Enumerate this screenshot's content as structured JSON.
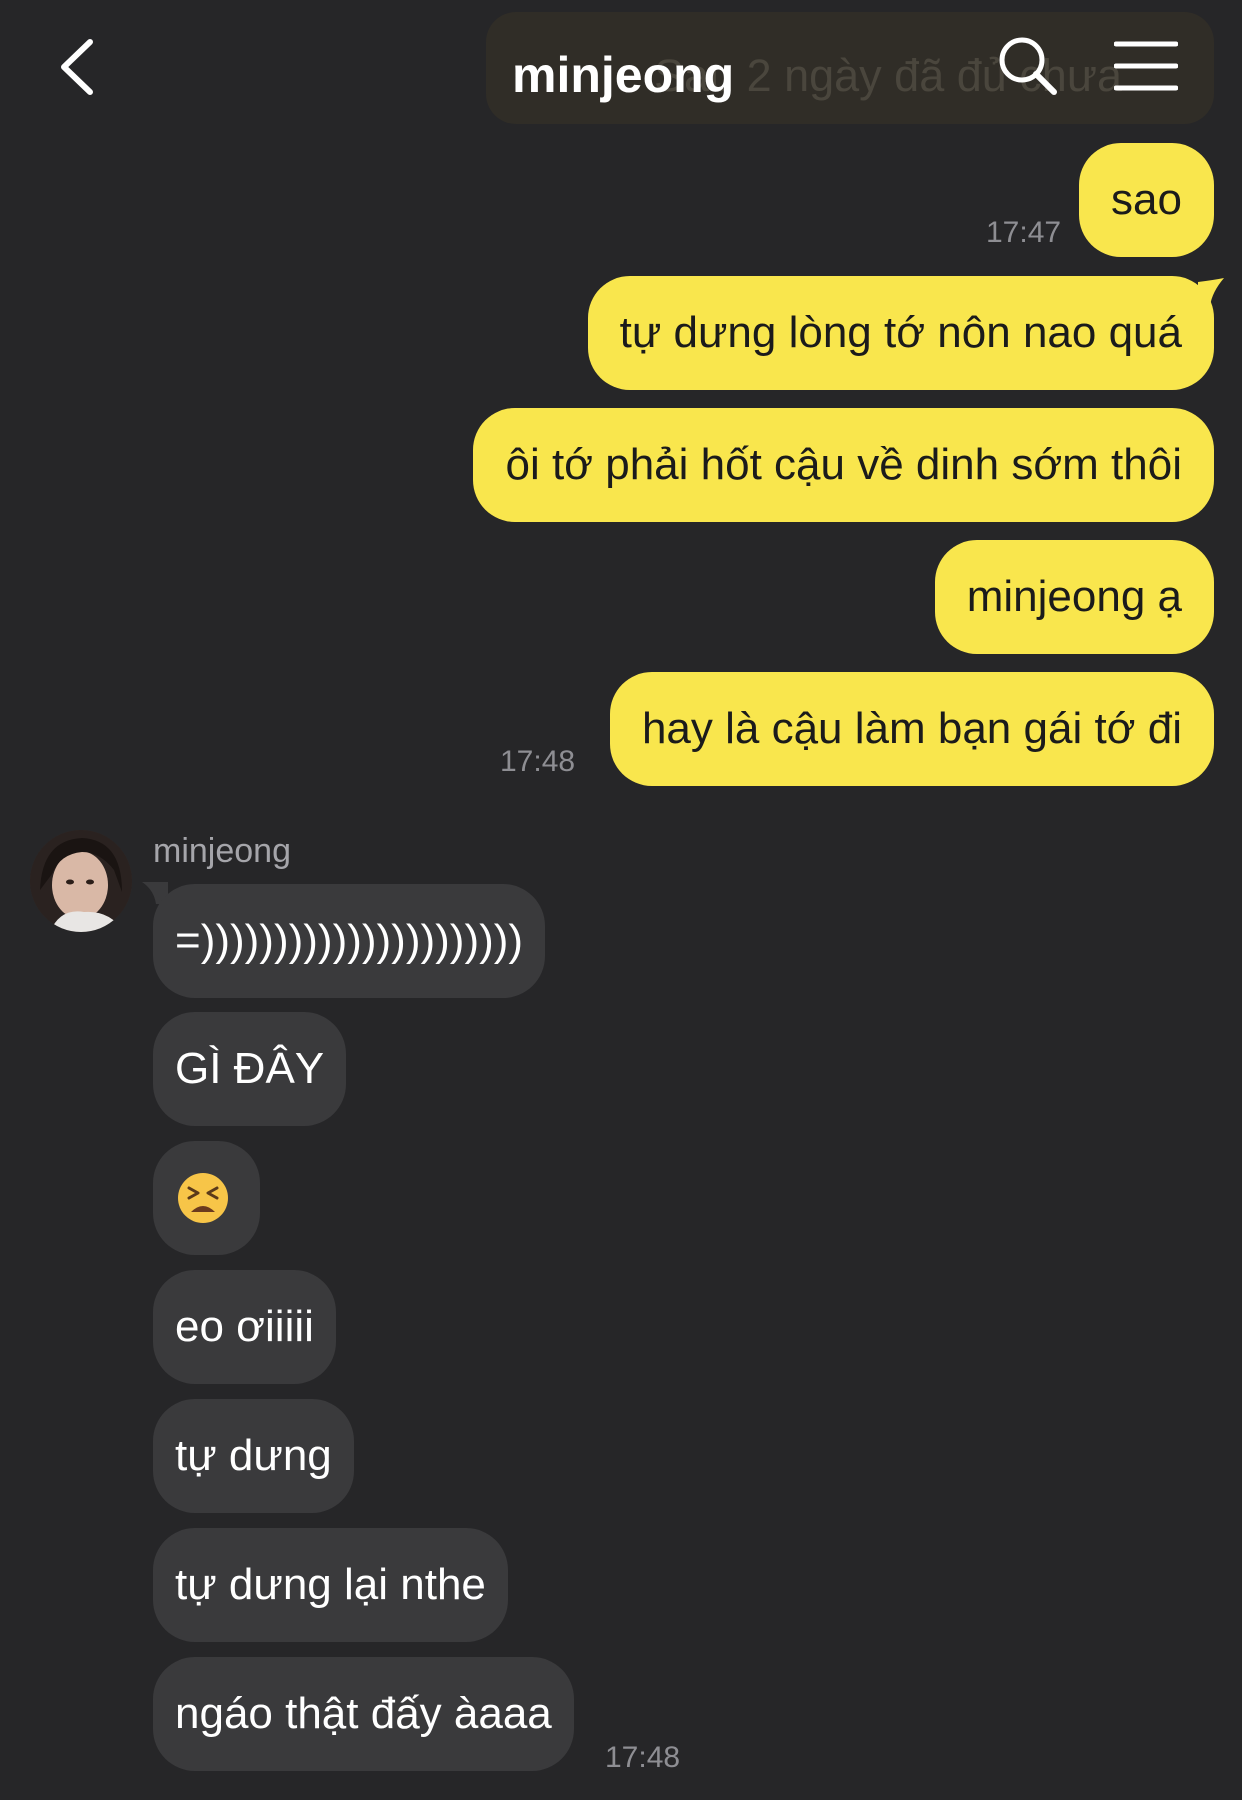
{
  "header": {
    "title": "minjeong",
    "ghost_text": "Sau 2 ngày đã đủ chưa"
  },
  "messages": {
    "outgoing": [
      {
        "text": "sao"
      },
      {
        "text": "tự dưng lòng tớ nôn nao quá"
      },
      {
        "text": "ôi tớ phải hốt cậu về dinh sớm thôi"
      },
      {
        "text": "minjeong ạ"
      },
      {
        "text": "hay là cậu làm bạn gái tớ đi"
      }
    ],
    "outgoing_times": [
      "17:47",
      "17:48"
    ],
    "sender_name": "minjeong",
    "incoming": [
      {
        "text": "=))))))))))))))))))))))"
      },
      {
        "text": "GÌ ĐÂY"
      },
      {
        "text": "😫",
        "icon": "tired-face-emoji"
      },
      {
        "text": "eo ơiiiii"
      },
      {
        "text": "tự dưng"
      },
      {
        "text": "tự dưng lại nthe"
      },
      {
        "text": "ngáo thật đấy àaaa"
      }
    ],
    "incoming_time": "17:48"
  },
  "colors": {
    "background": "#262628",
    "outgoing_bubble": "#f9e64d",
    "incoming_bubble": "#3a3a3c",
    "timestamp": "#8e8e93"
  }
}
